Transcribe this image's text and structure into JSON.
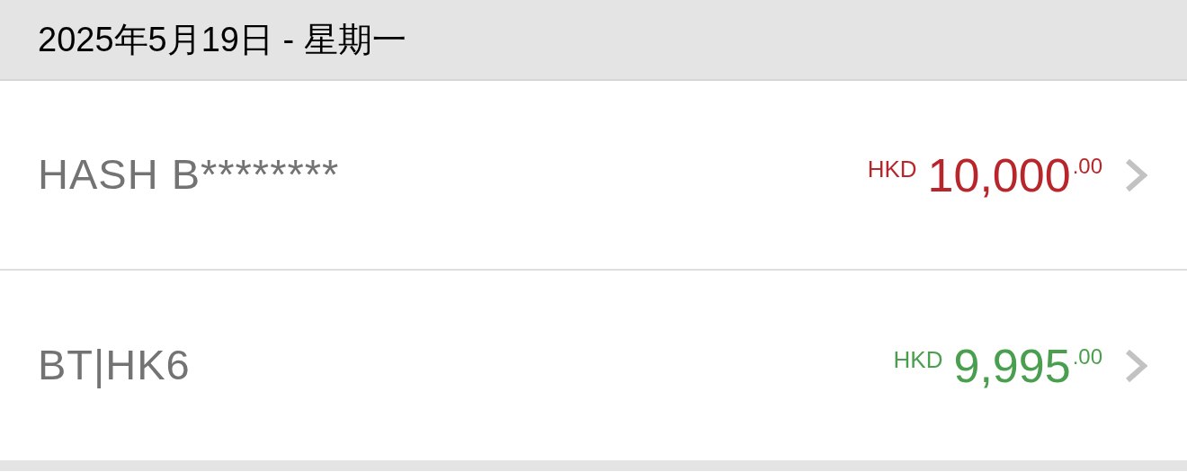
{
  "date_header": "2025年5月19日 - 星期一",
  "transactions": [
    {
      "name": "HASH B********",
      "currency": "HKD",
      "amount": "10,000",
      "decimals": ".00",
      "color": "#b8262b"
    },
    {
      "name": "BT|HK6",
      "currency": "HKD",
      "amount": "9,995",
      "decimals": ".00",
      "color": "#4a9f4f"
    }
  ]
}
